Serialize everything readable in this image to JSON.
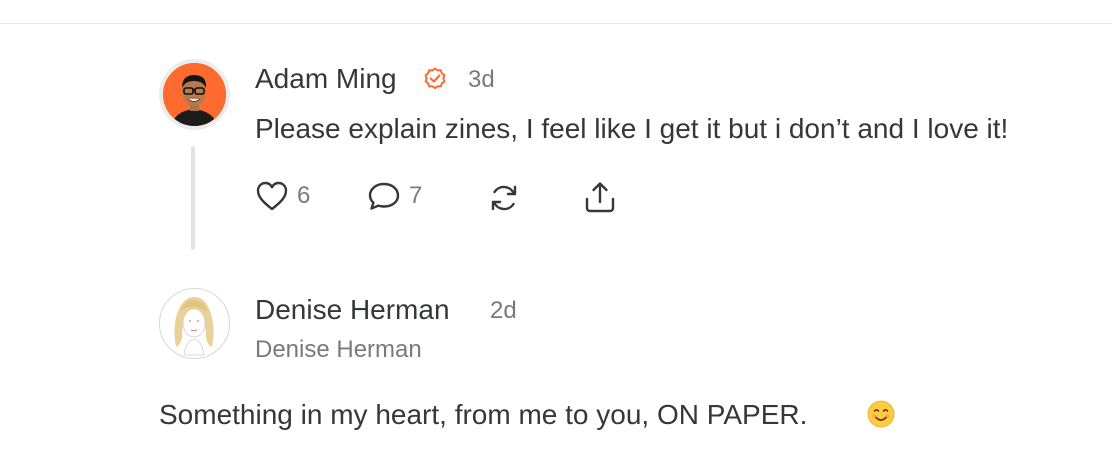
{
  "comments": [
    {
      "author": "Adam Ming",
      "time": "3d",
      "text": "Please explain zines, I feel like I get it but i don’t and I love it!",
      "likes": "6",
      "replies": "7",
      "verified_badge_icon": "check-circle-icon",
      "accent": "#ff6a2f"
    },
    {
      "author": "Denise Herman",
      "time": "2d",
      "subname": "Denise Herman",
      "text": "Something in my heart, from me to you, ON PAPER.",
      "emoji_icon": "smiling-face-icon"
    }
  ],
  "actions": {
    "like_icon": "heart-icon",
    "reply_icon": "comment-icon",
    "restack_icon": "restack-icon",
    "share_icon": "share-icon"
  }
}
